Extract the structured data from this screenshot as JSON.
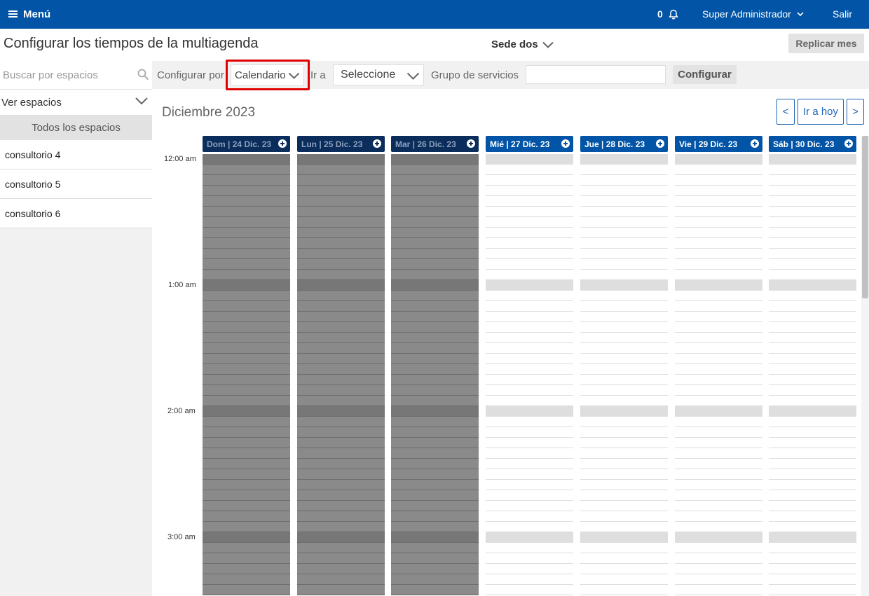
{
  "topbar": {
    "menu_label": "Menú",
    "notif_count": "0",
    "user_name": "Super Administrador",
    "logout_label": "Salir"
  },
  "header": {
    "title": "Configurar los tiempos de la multiagenda",
    "sede_label": "Sede dos",
    "replicate_label": "Replicar mes"
  },
  "sidebar": {
    "search_placeholder": "Buscar por espacios",
    "view_label": "Ver espacios",
    "all_label": "Todos los espacios",
    "items": [
      {
        "label": "consultorio 4"
      },
      {
        "label": "consultorio 5"
      },
      {
        "label": "consultorio 6"
      }
    ]
  },
  "filters": {
    "configure_by_label": "Configurar por",
    "configure_by_value": "Calendario",
    "goto_label": "Ir a",
    "goto_value": "Seleccione",
    "group_label": "Grupo de servicios",
    "group_value": "",
    "configure_button": "Configurar"
  },
  "calendar": {
    "month_label": "Diciembre 2023",
    "prev_label": "<",
    "today_label": "Ir a hoy",
    "next_label": ">",
    "time_labels": [
      "12:00 am",
      "1:00 am",
      "2:00 am",
      "3:00 am"
    ],
    "days": [
      {
        "label": "Dom | 24 Dic. 23",
        "state": "past"
      },
      {
        "label": "Lun | 25 Dic. 23",
        "state": "past"
      },
      {
        "label": "Mar | 26 Dic. 23",
        "state": "past"
      },
      {
        "label": "Mié | 27 Dic. 23",
        "state": "future"
      },
      {
        "label": "Jue | 28 Dic. 23",
        "state": "future"
      },
      {
        "label": "Vie | 29 Dic. 23",
        "state": "future"
      },
      {
        "label": "Sáb | 30 Dic. 23",
        "state": "future"
      }
    ]
  },
  "colors": {
    "brand": "#0154a6",
    "past_header": "#0b2d5c",
    "highlight": "#e00000"
  }
}
